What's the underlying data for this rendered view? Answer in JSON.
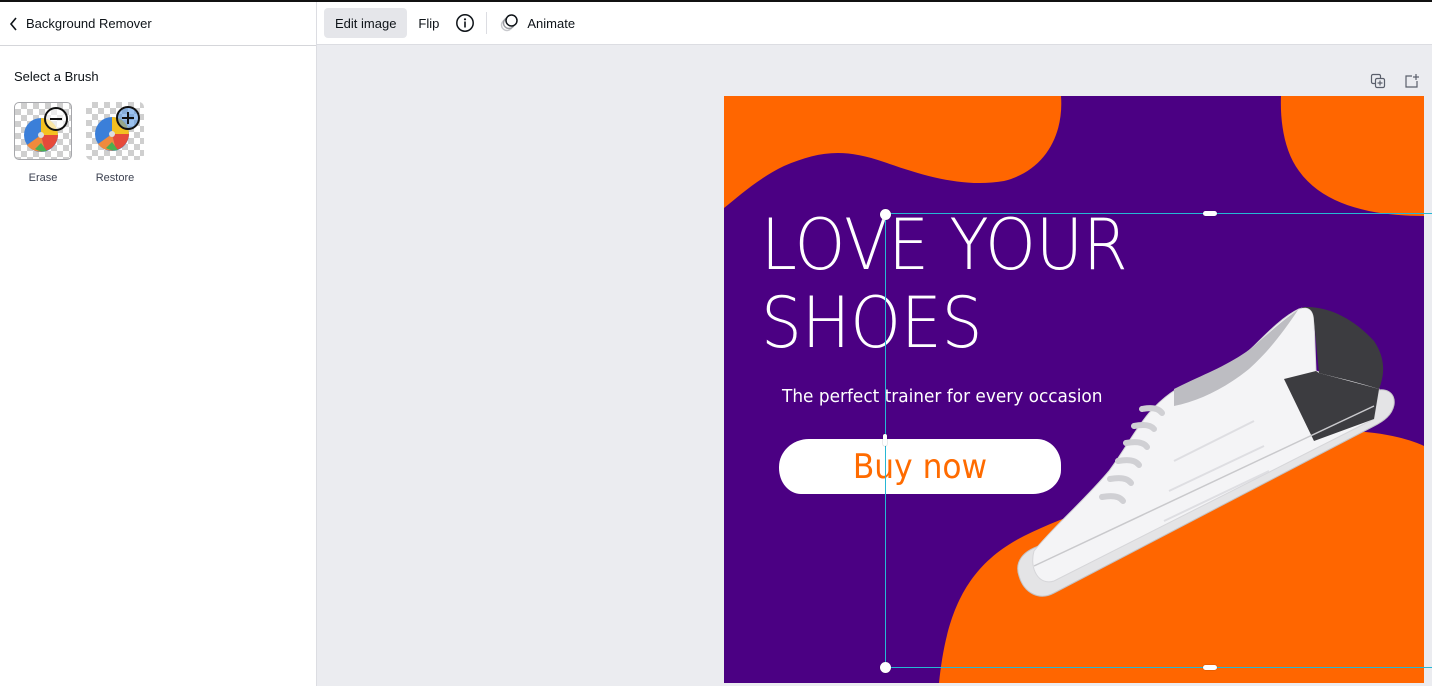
{
  "left_panel": {
    "back_label": "Background Remover",
    "section_label": "Select a Brush",
    "brushes": [
      {
        "label": "Erase",
        "icon": "minus-circle-icon",
        "selected": true
      },
      {
        "label": "Restore",
        "icon": "plus-circle-icon",
        "selected": false
      }
    ]
  },
  "toolbar": {
    "edit_image_label": "Edit image",
    "flip_label": "Flip",
    "info_icon": "info-icon",
    "animate_label": "Animate"
  },
  "page_actions": {
    "duplicate_icon": "duplicate-page-icon",
    "add_page_icon": "add-page-icon"
  },
  "design": {
    "headline_line1": "LOVE YOUR",
    "headline_line2": "SHOES",
    "subline": "The perfect trainer for every occasion",
    "cta_label": "Buy now",
    "colors": {
      "background": "#4b0083",
      "accent": "#ff6600",
      "text": "#ffffff",
      "selection": "#26b7d4"
    }
  }
}
